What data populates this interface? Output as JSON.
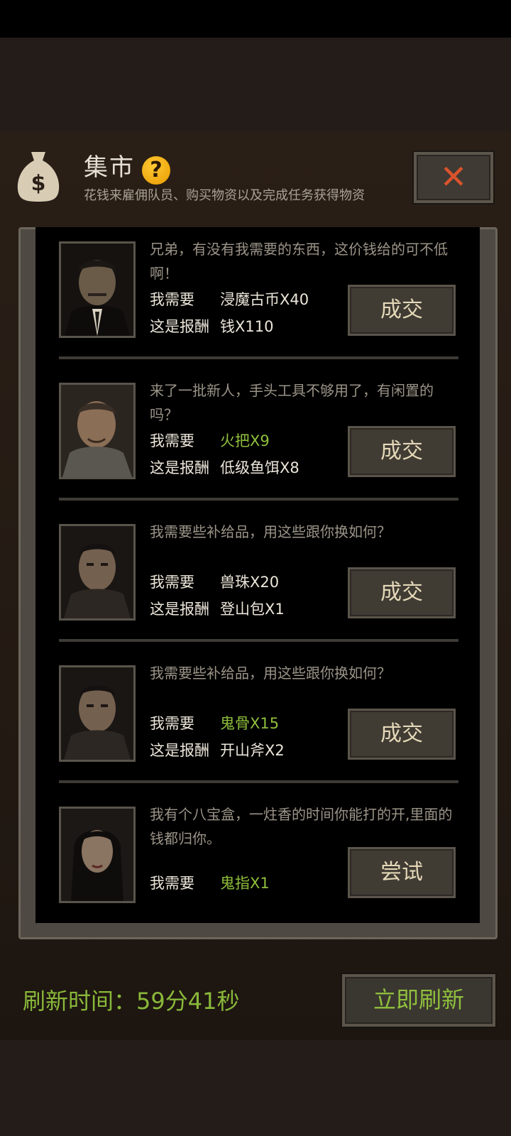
{
  "header": {
    "icon": "money-bag-icon",
    "title": "集市",
    "help_icon": "question-icon",
    "help_glyph": "?",
    "subtitle": "花钱来雇佣队员、购买物资以及完成任务获得物资",
    "close_glyph": "✕"
  },
  "colors": {
    "accent_green": "#8fbf3c",
    "help_yellow": "#f0a800",
    "close_red": "#d9532c",
    "button_text": "#e4d8b8"
  },
  "trades": [
    {
      "portrait": "man-in-suit-portrait",
      "dialog": "兄弟，有没有我需要的东西，这价钱给的可不低啊！",
      "need_label": "我需要",
      "need_value": "浸魔古币X40",
      "need_satisfied": false,
      "reward_label": "这是报酬",
      "reward_value": "钱X110",
      "button": "成交"
    },
    {
      "portrait": "older-man-portrait",
      "dialog": "来了一批新人，手头工具不够用了，有闲置的吗？",
      "need_label": "我需要",
      "need_value": "火把X9",
      "need_satisfied": true,
      "reward_label": "这是报酬",
      "reward_value": "低级鱼饵X8",
      "button": "成交"
    },
    {
      "portrait": "scarred-man-portrait",
      "dialog": "我需要些补给品，用这些跟你换如何？",
      "need_label": "我需要",
      "need_value": "兽珠X20",
      "need_satisfied": false,
      "reward_label": "这是报酬",
      "reward_value": "登山包X1",
      "button": "成交"
    },
    {
      "portrait": "scarred-man-portrait",
      "dialog": "我需要些补给品，用这些跟你换如何？",
      "need_label": "我需要",
      "need_value": "鬼骨X15",
      "need_satisfied": true,
      "reward_label": "这是报酬",
      "reward_value": "开山斧X2",
      "button": "成交"
    },
    {
      "portrait": "woman-portrait",
      "dialog": "我有个八宝盒，一炷香的时间你能打的开,里面的钱都归你。",
      "need_label": "我需要",
      "need_value": "鬼指X1",
      "need_satisfied": true,
      "button": "尝试"
    }
  ],
  "footer": {
    "refresh_time": "刷新时间：59分41秒",
    "refresh_button": "立即刷新"
  }
}
